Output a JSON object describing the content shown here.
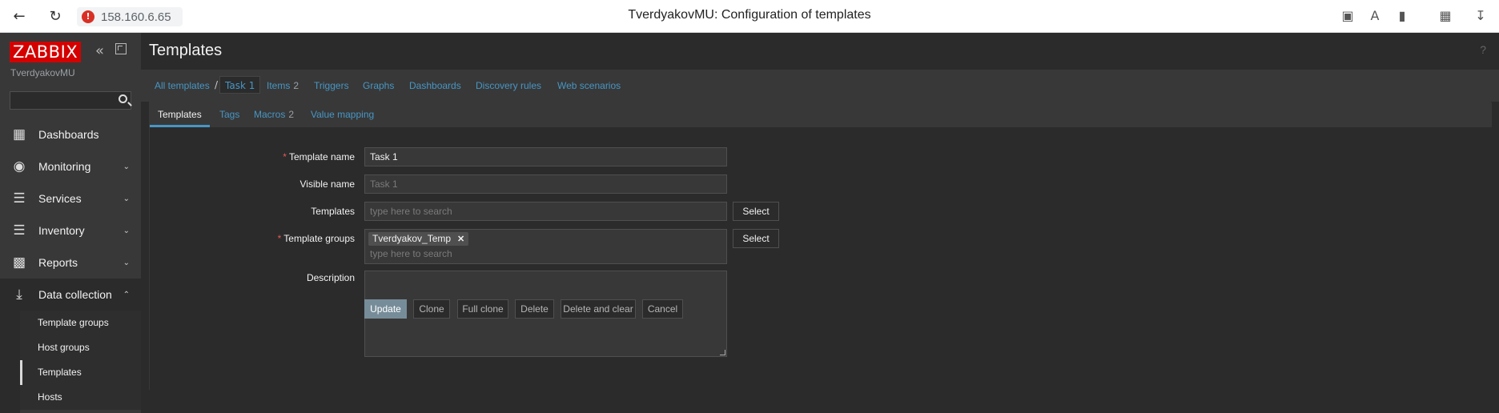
{
  "browser": {
    "url": "158.160.6.65",
    "window_title": "TverdyakovMU: Configuration of templates"
  },
  "sidebar": {
    "logo": "ZABBIX",
    "user": "TverdyakovMU",
    "menu": [
      {
        "label": "Dashboards",
        "icon": "dashboard-icon"
      },
      {
        "label": "Monitoring",
        "icon": "eye-icon"
      },
      {
        "label": "Services",
        "icon": "services-icon"
      },
      {
        "label": "Inventory",
        "icon": "list-icon"
      },
      {
        "label": "Reports",
        "icon": "report-icon"
      },
      {
        "label": "Data collection",
        "icon": "download-icon"
      }
    ],
    "submenu": [
      "Template groups",
      "Host groups",
      "Templates",
      "Hosts"
    ]
  },
  "main": {
    "title": "Templates",
    "help": "?",
    "nav": {
      "all_templates": "All templates",
      "separator": "/",
      "current": "Task 1",
      "items": "Items",
      "items_count": "2",
      "triggers": "Triggers",
      "graphs": "Graphs",
      "dashboards": "Dashboards",
      "discovery": "Discovery rules",
      "web": "Web scenarios"
    },
    "tabs": {
      "templates": "Templates",
      "tags": "Tags",
      "macros": "Macros",
      "macros_count": "2",
      "value_mapping": "Value mapping"
    },
    "form": {
      "template_name_label": "Template name",
      "template_name_value": "Task 1",
      "visible_name_label": "Visible name",
      "visible_name_placeholder": "Task 1",
      "templates_label": "Templates",
      "templates_placeholder": "type here to search",
      "template_groups_label": "Template groups",
      "template_groups_chip": "Tverdyakov_Temp",
      "template_groups_placeholder": "type here to search",
      "description_label": "Description",
      "select_label": "Select",
      "required_mark": "*"
    },
    "actions": {
      "update": "Update",
      "clone": "Clone",
      "full_clone": "Full clone",
      "delete": "Delete",
      "delete_clear": "Delete and clear",
      "cancel": "Cancel"
    }
  },
  "colors": {
    "accent": "#4796c4",
    "logo_red": "#d40000",
    "primary_button": "#768d99"
  }
}
